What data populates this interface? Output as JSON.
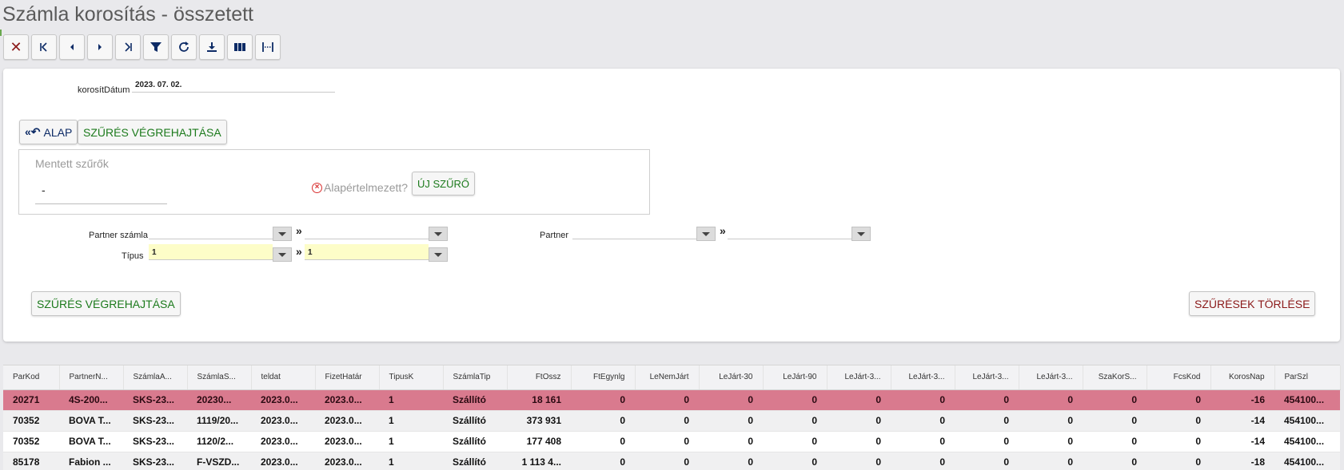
{
  "page": {
    "title": "Számla korosítás - összetett"
  },
  "toolbar": {
    "buttons": [
      {
        "name": "close-button",
        "icon": "close-icon"
      },
      {
        "name": "first-record-button",
        "icon": "first-icon"
      },
      {
        "name": "prev-record-button",
        "icon": "prev-icon"
      },
      {
        "name": "next-record-button",
        "icon": "next-icon"
      },
      {
        "name": "last-record-button",
        "icon": "last-icon"
      },
      {
        "name": "filter-button",
        "icon": "filter-icon"
      },
      {
        "name": "refresh-button",
        "icon": "refresh-icon"
      },
      {
        "name": "download-button",
        "icon": "download-icon"
      },
      {
        "name": "columns-button",
        "icon": "columns-icon"
      },
      {
        "name": "fit-columns-button",
        "icon": "fit-columns-icon"
      }
    ]
  },
  "filters": {
    "date_label": "korosítDátum",
    "date_value": "2023. 07. 02.",
    "alap_label": "ALAP",
    "execute_top_label": "SZŰRÉS VÉGREHAJTÁSA",
    "saved_filters_title": "Mentett szűrők",
    "saved_filters_value": "-",
    "default_label": "Alapértelmezett?",
    "new_filter_label": "ÚJ SZŰRŐ",
    "partner_account_label": "Partner számla",
    "partner_account_from": "",
    "partner_account_to": "",
    "partner_label": "Partner",
    "partner_from": "",
    "partner_to": "",
    "type_label": "Típus",
    "type_from": "1",
    "type_to": "1",
    "range_sep": "»",
    "execute_bottom_label": "SZŰRÉS VÉGREHAJTÁSA",
    "clear_filters_label": "SZŰRÉSEK TÖRLÉSE"
  },
  "grid": {
    "columns": [
      "ParKod",
      "PartnerN...",
      "SzámlaA...",
      "SzámlaS...",
      "teldat",
      "FizetHatár",
      "TipusK",
      "SzámlaTip",
      "FtOssz",
      "FtEgynlg",
      "LeNemJárt",
      "LeJárt-30",
      "LeJárt-90",
      "LeJárt-3...",
      "LeJárt-3...",
      "LeJárt-3...",
      "LeJárt-3...",
      "SzaKorS...",
      "FcsKod",
      "KorosNap",
      "ParSzl"
    ],
    "rows": [
      [
        "20271",
        "4S-200...",
        "SKS-23...",
        "20230...",
        "2023.0...",
        "2023.0...",
        "1",
        "Szállító",
        "18 161",
        "0",
        "0",
        "0",
        "0",
        "0",
        "0",
        "0",
        "0",
        "0",
        "0",
        "-16",
        "454100..."
      ],
      [
        "70352",
        "BOVA T...",
        "SKS-23...",
        "1119/20...",
        "2023.0...",
        "2023.0...",
        "1",
        "Szállító",
        "373 931",
        "0",
        "0",
        "0",
        "0",
        "0",
        "0",
        "0",
        "0",
        "0",
        "0",
        "-14",
        "454100..."
      ],
      [
        "70352",
        "BOVA T...",
        "SKS-23...",
        "1120/2...",
        "2023.0...",
        "2023.0...",
        "1",
        "Szállító",
        "177 408",
        "0",
        "0",
        "0",
        "0",
        "0",
        "0",
        "0",
        "0",
        "0",
        "0",
        "-14",
        "454100..."
      ],
      [
        "85178",
        "Fabion ...",
        "SKS-23...",
        "F-VSZD...",
        "2023.0...",
        "2023.0...",
        "1",
        "Szállító",
        "1 113 4...",
        "0",
        "0",
        "0",
        "0",
        "0",
        "0",
        "0",
        "0",
        "0",
        "0",
        "-18",
        "454100..."
      ]
    ]
  },
  "colors": {
    "selected_row": "#d97a8e",
    "accent_green": "#1c7a1c",
    "accent_red": "#8b1a1a",
    "accent_blue": "#0d2b66",
    "type_highlight": "#fdfdc8"
  }
}
